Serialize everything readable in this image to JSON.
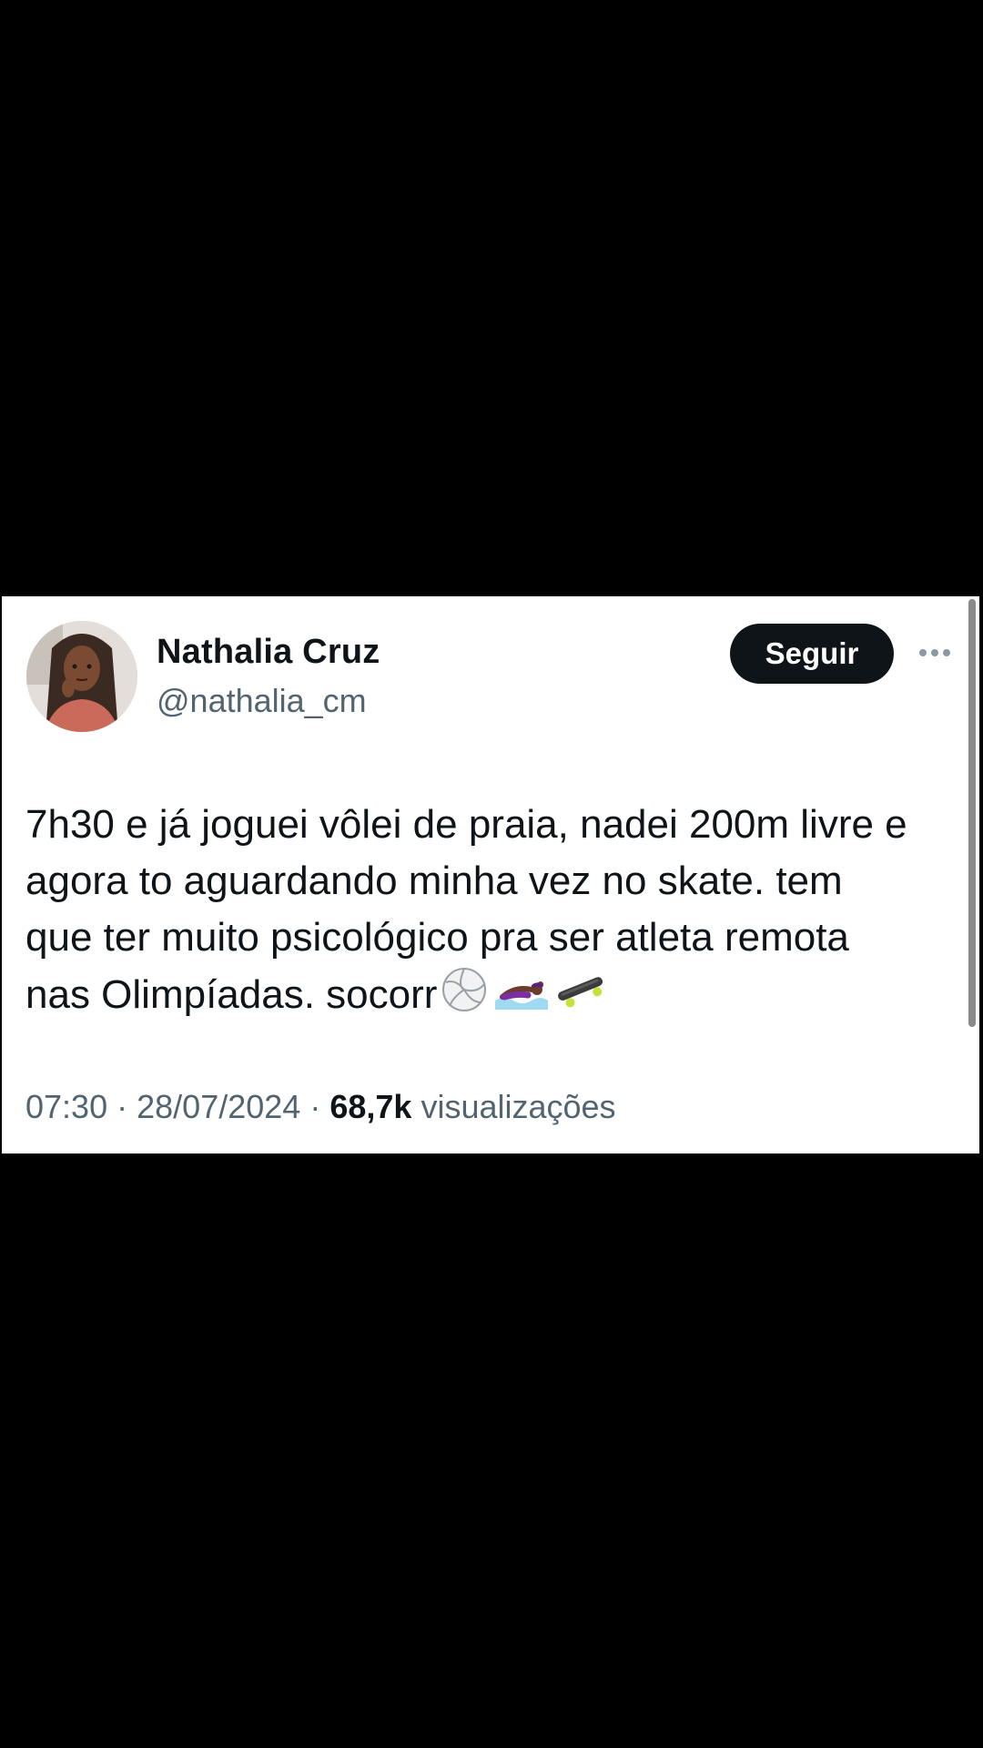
{
  "tweet": {
    "author_name": "Nathalia Cruz",
    "author_handle": "@nathalia_cm",
    "follow_label": "Seguir",
    "more_icon": "more-horizontal-icon",
    "text_lines": [
      "7h30 e já joguei vôlei de praia, nadei 200m livre e",
      "agora to aguardando minha vez no skate. tem",
      "que ter muito psicológico pra ser atleta remota",
      "nas Olimpíadas. socorr"
    ],
    "emojis": [
      "volleyball-icon",
      "swimmer-icon",
      "skateboard-icon"
    ],
    "time": "07:30",
    "separator": "·",
    "date": "28/07/2024",
    "views_count": "68,7k",
    "views_label": "visualizações"
  },
  "colors": {
    "background": "#000000",
    "card": "#ffffff",
    "text_primary": "#0f1419",
    "text_secondary": "#536471",
    "follow_button_bg": "#0f1419"
  }
}
